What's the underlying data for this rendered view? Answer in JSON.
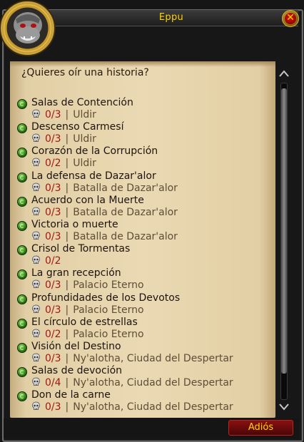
{
  "window": {
    "title": "Eppu"
  },
  "greeting": "¿Quieres oír una historia?",
  "quests": [
    {
      "name": "Salas de Contención",
      "progress": "0/3",
      "location": "Uldir"
    },
    {
      "name": "Descenso Carmesí",
      "progress": "0/3",
      "location": "Uldir"
    },
    {
      "name": "Corazón de la Corrupción",
      "progress": "0/2",
      "location": "Uldir"
    },
    {
      "name": "La defensa de Dazar'alor",
      "progress": "0/3",
      "location": "Batalla de Dazar'alor"
    },
    {
      "name": "Acuerdo con la Muerte",
      "progress": "0/3",
      "location": "Batalla de Dazar'alor"
    },
    {
      "name": "Victoria o muerte",
      "progress": "0/3",
      "location": "Batalla de Dazar'alor"
    },
    {
      "name": "Crisol de Tormentas",
      "progress": "0/2",
      "location": ""
    },
    {
      "name": "La gran recepción",
      "progress": "0/3",
      "location": "Palacio Eterno"
    },
    {
      "name": "Profundidades de los Devotos",
      "progress": "0/3",
      "location": "Palacio Eterno"
    },
    {
      "name": "El círculo de estrellas",
      "progress": "0/2",
      "location": "Palacio Eterno"
    },
    {
      "name": "Visión del Destino",
      "progress": "0/3",
      "location": "Ny'alotha, Ciudad del Despertar"
    },
    {
      "name": "Salas de devoción",
      "progress": "0/4",
      "location": "Ny'alotha, Ciudad del Despertar"
    },
    {
      "name": "Don de la carne",
      "progress": "0/3",
      "location": "Ny'alotha, Ciudad del Despertar"
    }
  ],
  "separator": "|",
  "buttons": {
    "goodbye": "Adiós",
    "close": "✕"
  },
  "icons": {
    "quest": "quest-available-icon",
    "difficulty": "skull-icon",
    "portrait": "npc-portrait-icon"
  },
  "colors": {
    "title": "#ffd200",
    "progress": "#a21818",
    "parchment": "#ead9b3",
    "button": "#8a1010"
  }
}
